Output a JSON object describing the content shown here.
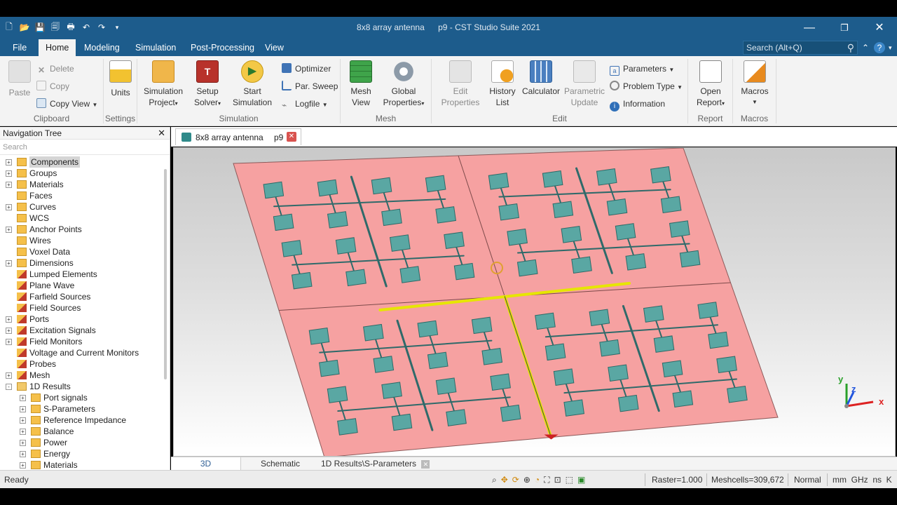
{
  "window": {
    "title_left": "8x8 array antenna",
    "title_right": "p9 - CST Studio Suite 2021"
  },
  "menu": {
    "tabs": [
      "File",
      "Home",
      "Modeling",
      "Simulation",
      "Post-Processing",
      "View"
    ],
    "active": "Home",
    "search_placeholder": "Search (Alt+Q)"
  },
  "ribbon": {
    "clipboard": {
      "paste": "Paste",
      "delete": "Delete",
      "copy": "Copy",
      "copy_view": "Copy View",
      "label": "Clipboard"
    },
    "settings": {
      "units": "Units",
      "label": "Settings"
    },
    "simulation": {
      "sim_project_1": "Simulation",
      "sim_project_2": "Project",
      "setup_1": "Setup",
      "setup_2": "Solver",
      "start_1": "Start",
      "start_2": "Simulation",
      "optimizer": "Optimizer",
      "par_sweep": "Par. Sweep",
      "logfile": "Logfile",
      "label": "Simulation"
    },
    "mesh": {
      "mesh_view_1": "Mesh",
      "mesh_view_2": "View",
      "global_1": "Global",
      "global_2": "Properties",
      "label": "Mesh"
    },
    "edit": {
      "edit_props_1": "Edit",
      "edit_props_2": "Properties",
      "history_1": "History",
      "history_2": "List",
      "calculator": "Calculator",
      "param_update_1": "Parametric",
      "param_update_2": "Update",
      "parameters": "Parameters",
      "problem_type": "Problem Type",
      "information": "Information",
      "label": "Edit"
    },
    "report": {
      "open_1": "Open",
      "open_2": "Report",
      "label": "Report"
    },
    "macros": {
      "macros": "Macros",
      "label": "Macros"
    }
  },
  "nav": {
    "title": "Navigation Tree",
    "search": "Search",
    "items": [
      {
        "label": "Components",
        "level": 0,
        "exp": "+",
        "type": "folder",
        "selected": true
      },
      {
        "label": "Groups",
        "level": 0,
        "exp": "+",
        "type": "folder"
      },
      {
        "label": "Materials",
        "level": 0,
        "exp": "+",
        "type": "folder"
      },
      {
        "label": "Faces",
        "level": 0,
        "exp": "",
        "type": "folder"
      },
      {
        "label": "Curves",
        "level": 0,
        "exp": "+",
        "type": "folder"
      },
      {
        "label": "WCS",
        "level": 0,
        "exp": "",
        "type": "folder"
      },
      {
        "label": "Anchor Points",
        "level": 0,
        "exp": "+",
        "type": "folder"
      },
      {
        "label": "Wires",
        "level": 0,
        "exp": "",
        "type": "folder"
      },
      {
        "label": "Voxel Data",
        "level": 0,
        "exp": "",
        "type": "folder"
      },
      {
        "label": "Dimensions",
        "level": 0,
        "exp": "+",
        "type": "folder"
      },
      {
        "label": "Lumped Elements",
        "level": 0,
        "exp": "",
        "type": "red"
      },
      {
        "label": "Plane Wave",
        "level": 0,
        "exp": "",
        "type": "red"
      },
      {
        "label": "Farfield Sources",
        "level": 0,
        "exp": "",
        "type": "red"
      },
      {
        "label": "Field Sources",
        "level": 0,
        "exp": "",
        "type": "red"
      },
      {
        "label": "Ports",
        "level": 0,
        "exp": "+",
        "type": "red"
      },
      {
        "label": "Excitation Signals",
        "level": 0,
        "exp": "+",
        "type": "red"
      },
      {
        "label": "Field Monitors",
        "level": 0,
        "exp": "+",
        "type": "red"
      },
      {
        "label": "Voltage and Current Monitors",
        "level": 0,
        "exp": "",
        "type": "red"
      },
      {
        "label": "Probes",
        "level": 0,
        "exp": "",
        "type": "red"
      },
      {
        "label": "Mesh",
        "level": 0,
        "exp": "+",
        "type": "red"
      },
      {
        "label": "1D Results",
        "level": 0,
        "exp": "-",
        "type": "open"
      },
      {
        "label": "Port signals",
        "level": 1,
        "exp": "+",
        "type": "folder"
      },
      {
        "label": "S-Parameters",
        "level": 1,
        "exp": "+",
        "type": "folder"
      },
      {
        "label": "Reference Impedance",
        "level": 1,
        "exp": "+",
        "type": "folder"
      },
      {
        "label": "Balance",
        "level": 1,
        "exp": "+",
        "type": "folder"
      },
      {
        "label": "Power",
        "level": 1,
        "exp": "+",
        "type": "folder"
      },
      {
        "label": "Energy",
        "level": 1,
        "exp": "+",
        "type": "folder"
      },
      {
        "label": "Materials",
        "level": 1,
        "exp": "+",
        "type": "folder"
      }
    ]
  },
  "doc_tab": {
    "name": "8x8 array antenna",
    "param": "p9"
  },
  "bottom_tabs": [
    "3D",
    "Schematic",
    "1D Results\\S-Parameters"
  ],
  "axes": {
    "x": "x",
    "y": "y",
    "z": "z"
  },
  "status": {
    "ready": "Ready",
    "raster": "Raster=1.000",
    "meshcells": "Meshcells=309,672",
    "mode": "Normal",
    "units": "mm  GHz  ns  K"
  },
  "colors": {
    "substrate": "#f6a1a1",
    "patch": "#5aa7a3",
    "feed": "#e6e600",
    "titlebar": "#1d5c8c"
  }
}
